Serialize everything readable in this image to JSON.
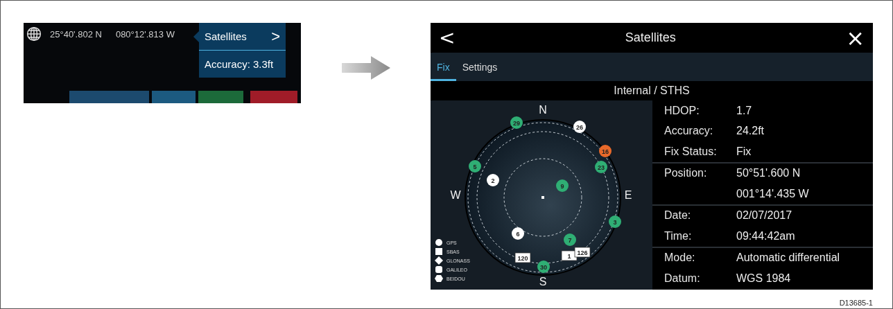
{
  "status_bar": {
    "latitude": "25°40'.802 N",
    "longitude": "080°12'.813 W"
  },
  "popup": {
    "title": "Satellites",
    "chevron": ">",
    "accuracy": "Accuracy: 3.3ft"
  },
  "dialog": {
    "title": "Satellites",
    "back": "<",
    "close": "×",
    "tabs": [
      {
        "label": "Fix",
        "selected": true
      },
      {
        "label": "Settings",
        "selected": false
      }
    ],
    "source": "Internal / STHS",
    "compass": [
      "N",
      "W",
      "E",
      "S"
    ],
    "satellites": [
      {
        "id": "29",
        "kind": "gps",
        "color": "#2fae74"
      },
      {
        "id": "26",
        "kind": "gps",
        "color": "#ffffff"
      },
      {
        "id": "16",
        "kind": "gps",
        "color": "#e8692a"
      },
      {
        "id": "23",
        "kind": "gps",
        "color": "#2fae74"
      },
      {
        "id": "5",
        "kind": "gps",
        "color": "#2fae74"
      },
      {
        "id": "2",
        "kind": "gps",
        "color": "#ffffff"
      },
      {
        "id": "9",
        "kind": "gps",
        "color": "#2fae74"
      },
      {
        "id": "3",
        "kind": "gps",
        "color": "#2fae74"
      },
      {
        "id": "6",
        "kind": "gps",
        "color": "#ffffff"
      },
      {
        "id": "7",
        "kind": "gps",
        "color": "#2fae74"
      },
      {
        "id": "30",
        "kind": "gps",
        "color": "#2fae74"
      },
      {
        "id": "120",
        "kind": "sbas",
        "color": "#ffffff"
      },
      {
        "id": "1",
        "kind": "sbas",
        "color": "#ffffff"
      },
      {
        "id": "126",
        "kind": "sbas",
        "color": "#ffffff"
      }
    ],
    "legend": [
      {
        "label": "GPS",
        "kind": "circle"
      },
      {
        "label": "SBAS",
        "kind": "square"
      },
      {
        "label": "GLONASS",
        "kind": "diamond"
      },
      {
        "label": "GALILEO",
        "kind": "rounded"
      },
      {
        "label": "BEIDOU",
        "kind": "hexagon"
      }
    ],
    "groups": [
      [
        {
          "label": "HDOP:",
          "value": "1.7"
        },
        {
          "label": "Accuracy:",
          "value": "24.2ft"
        },
        {
          "label": "Fix Status:",
          "value": "Fix"
        }
      ],
      [
        {
          "label": "Position:",
          "value": "50°51'.600 N"
        },
        {
          "value": "001°14'.435 W"
        }
      ],
      [
        {
          "label": "Date:",
          "value": "02/07/2017"
        },
        {
          "label": "Time:",
          "value": "09:44:42am"
        }
      ],
      [
        {
          "label": "Mode:",
          "value": "Automatic differential"
        },
        {
          "label": "Datum:",
          "value": "WGS 1984"
        }
      ]
    ]
  },
  "figure_code": "D13685-1"
}
